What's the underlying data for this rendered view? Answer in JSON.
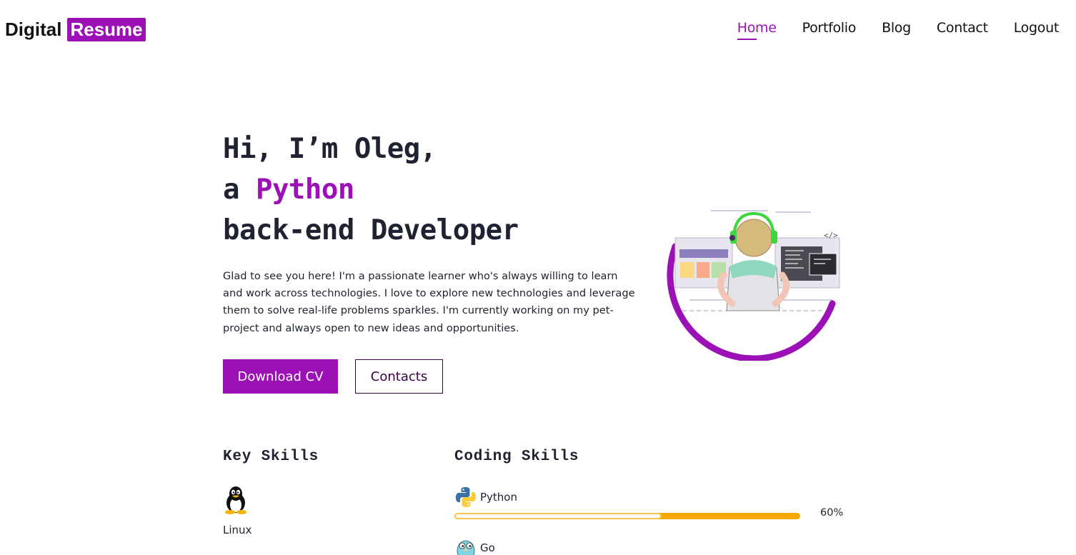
{
  "brand": {
    "part1": "Digital",
    "part2": "Resume",
    "accent_color": "#9b11b6"
  },
  "nav": {
    "items": [
      {
        "label": "Home",
        "active": true
      },
      {
        "label": "Portfolio",
        "active": false
      },
      {
        "label": "Blog",
        "active": false
      },
      {
        "label": "Contact",
        "active": false
      },
      {
        "label": "Logout",
        "active": false
      }
    ]
  },
  "hero": {
    "line1": "Hi, I’m Oleg,",
    "line2_prefix": "a ",
    "line2_accent": "Python",
    "line3": "back-end Developer",
    "description": "Glad to see you here! I'm a passionate learner who's always willing to learn and work across technologies. I love to explore new technologies and leverage them to solve real-life problems sparkles. I'm currently working on my pet-project and always open to new ideas and opportunities.",
    "primary_button": "Download CV",
    "secondary_button": "Contacts",
    "illustration_icon": "developer-at-desk-illustration"
  },
  "key_skills": {
    "heading": "Key Skills",
    "items": [
      {
        "label": "Linux",
        "icon": "tux-penguin-icon"
      }
    ]
  },
  "coding_skills": {
    "heading": "Coding Skills",
    "items": [
      {
        "name": "Python",
        "icon": "python-logo-icon",
        "percent_label": "60%",
        "level": 0.6
      },
      {
        "name": "Go",
        "icon": "gopher-icon"
      }
    ],
    "bar_color": "#f6a800"
  }
}
